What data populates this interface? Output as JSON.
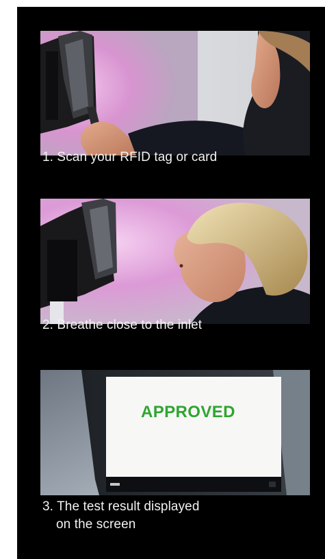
{
  "steps": [
    {
      "caption": "1. Scan your RFID tag or card",
      "image": "person-scanning-rfid-tag-at-terminal"
    },
    {
      "caption": "2. Breathe close to the inlet",
      "image": "person-breathing-into-device-inlet"
    },
    {
      "caption_line1": "3. The test result displayed",
      "caption_line2": "on the screen",
      "image": "device-screen-showing-result",
      "screen_text": "APPROVED"
    }
  ],
  "colors": {
    "panel_background": "#000000",
    "caption_text": "#f2f2f2",
    "approved_text": "#2fa531",
    "photo_glow": "#e8a6dc"
  }
}
